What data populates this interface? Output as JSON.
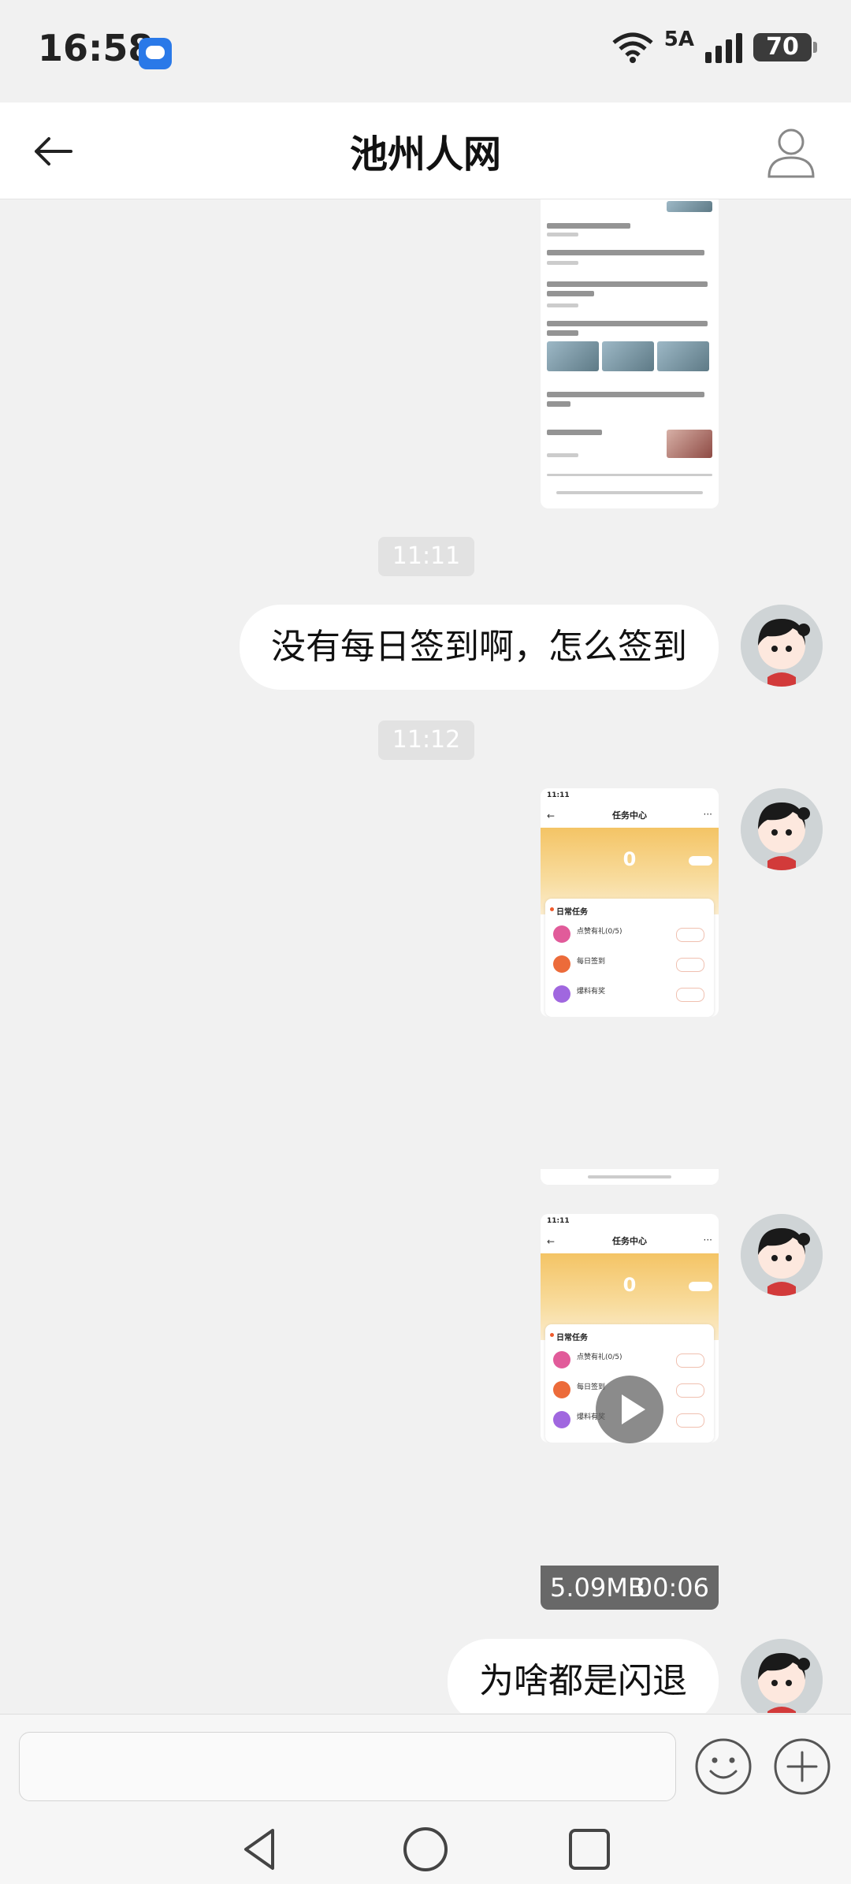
{
  "status_bar": {
    "time": "16:58",
    "network": "5A",
    "battery": "70"
  },
  "header": {
    "title": "池州人网"
  },
  "messages": {
    "ts1": "11:11",
    "text1": "没有每日签到啊，怎么签到",
    "ts2": "11:12",
    "text2": "为啥都是闪退",
    "video": {
      "size": "5.09MB",
      "duration": "00:06"
    }
  },
  "task_screenshot": {
    "time": "11:11",
    "title": "任务中心",
    "points": "0",
    "section": "日常任务",
    "tasks": [
      {
        "name": "点赞有礼(0/5)"
      },
      {
        "name": "每日签到"
      },
      {
        "name": "爆料有奖"
      }
    ]
  },
  "colors": {
    "background": "#f1f1f1",
    "bubble": "#ffffff",
    "accent_orange": "#f4c465"
  },
  "icons": [
    "back-arrow-icon",
    "profile-icon",
    "emoji-icon",
    "plus-icon",
    "play-icon"
  ]
}
